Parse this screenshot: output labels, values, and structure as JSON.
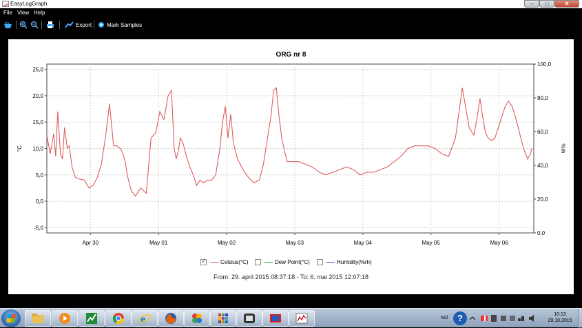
{
  "window": {
    "title": "EasyLogGraph"
  },
  "window_controls": {
    "minimize": "–",
    "maximize": "□",
    "close": "✕"
  },
  "menu": {
    "items": [
      "File",
      "View",
      "Help"
    ]
  },
  "toolbar": {
    "export_label": "Export",
    "mark_samples_label": "Mark Samples"
  },
  "chart_data": {
    "type": "line",
    "title": "ORG nr 8",
    "ylabel": "°C",
    "y2label": "%rh",
    "ylim": [
      -6,
      26
    ],
    "y2lim": [
      0,
      100
    ],
    "yticks": [
      "25,0",
      "20,0",
      "15,0",
      "10,0",
      "5,0",
      "0,0",
      "-5,0"
    ],
    "y2ticks": [
      "100,0",
      "80,0",
      "60,0",
      "40,0",
      "20,0",
      "0,0"
    ],
    "xticks": [
      "Apr 30",
      "May 01",
      "May 02",
      "May 03",
      "May 04",
      "May 05",
      "May 06"
    ],
    "x_range_days": [
      0,
      7.15
    ],
    "grid": true,
    "series": [
      {
        "name": "Celsius(°C)",
        "color": "#e05a5a",
        "x_days": [
          0,
          0.05,
          0.1,
          0.13,
          0.16,
          0.2,
          0.23,
          0.26,
          0.3,
          0.33,
          0.37,
          0.42,
          0.48,
          0.55,
          0.62,
          0.68,
          0.74,
          0.8,
          0.86,
          0.92,
          0.98,
          1.03,
          1.08,
          1.12,
          1.15,
          1.18,
          1.21,
          1.24,
          1.3,
          1.38,
          1.46,
          1.53,
          1.6,
          1.66,
          1.72,
          1.78,
          1.83,
          1.87,
          1.9,
          1.93,
          1.96,
          2.0,
          2.05,
          2.1,
          2.15,
          2.2,
          2.25,
          2.3,
          2.36,
          2.42,
          2.48,
          2.54,
          2.58,
          2.62,
          2.66,
          2.7,
          2.74,
          2.8,
          2.88,
          2.96,
          3.04,
          3.12,
          3.18,
          3.24,
          3.29,
          3.33,
          3.37,
          3.41,
          3.45,
          3.49,
          3.53,
          3.6,
          3.7,
          3.8,
          3.9,
          4.0,
          4.1,
          4.2,
          4.3,
          4.4,
          4.5,
          4.6,
          4.7,
          4.8,
          4.9,
          5.0,
          5.1,
          5.2,
          5.3,
          5.4,
          5.5,
          5.6,
          5.7,
          5.8,
          5.9,
          6.0,
          6.1,
          6.2,
          6.27,
          6.32,
          6.36,
          6.4,
          6.44,
          6.48,
          6.53,
          6.58,
          6.63,
          6.68,
          6.73,
          6.78,
          6.83,
          6.88,
          6.92,
          6.96,
          7.0,
          7.03,
          7.06,
          7.1,
          7.12
        ],
        "values": [
          12.5,
          9,
          12.8,
          8.5,
          17,
          9,
          8,
          14,
          10,
          10.5,
          6.5,
          4.5,
          4.2,
          4,
          2.5,
          3,
          4.5,
          7,
          12,
          18.5,
          10.5,
          10.5,
          10,
          9,
          7.5,
          5,
          3.5,
          2,
          1,
          2.5,
          1.5,
          12,
          13,
          17,
          15.5,
          20,
          21,
          10,
          8,
          9.5,
          12,
          11,
          8.5,
          6.5,
          5,
          3,
          4,
          3.5,
          4,
          4,
          5,
          10,
          15,
          18,
          12,
          16.5,
          11,
          8,
          6,
          4.5,
          3.5,
          4,
          7,
          12,
          16,
          21,
          21.5,
          16,
          12,
          9.5,
          7.5,
          7.5,
          7.5,
          7,
          6.5,
          5.5,
          5,
          5.5,
          6,
          6.5,
          6,
          5,
          5.5,
          5.5,
          6,
          6.5,
          7.5,
          8.5,
          10,
          10.5,
          10.5,
          10.5,
          10,
          9,
          8.5,
          12,
          21.5,
          14,
          12.5,
          16,
          19.5,
          16,
          13,
          12,
          11.5,
          12,
          14,
          16,
          18,
          19,
          18,
          16,
          14,
          12,
          10,
          9,
          8,
          9,
          10
        ]
      },
      {
        "name": "Dew Point(°C)",
        "color": "#3aa33a",
        "values": []
      },
      {
        "name": "Humidity(%rh)",
        "color": "#2f4fc8",
        "values": []
      }
    ],
    "legend_position": "bottom",
    "legend_checked": [
      true,
      false,
      false
    ]
  },
  "range_text": "From: 29. april 2015 08:37:18  -  To: 6. mai 2015 12:07:18",
  "taskbar": {
    "apps": [
      "file-explorer",
      "media-player",
      "green-chart-app",
      "chrome",
      "internet-explorer",
      "firefox",
      "photos",
      "launcher-grid",
      "video-player",
      "media-tool",
      "easyloggraph"
    ]
  },
  "tray": {
    "language": "NO",
    "help": "?"
  },
  "clock": {
    "time": "10:13",
    "date": "29.10.2015"
  }
}
